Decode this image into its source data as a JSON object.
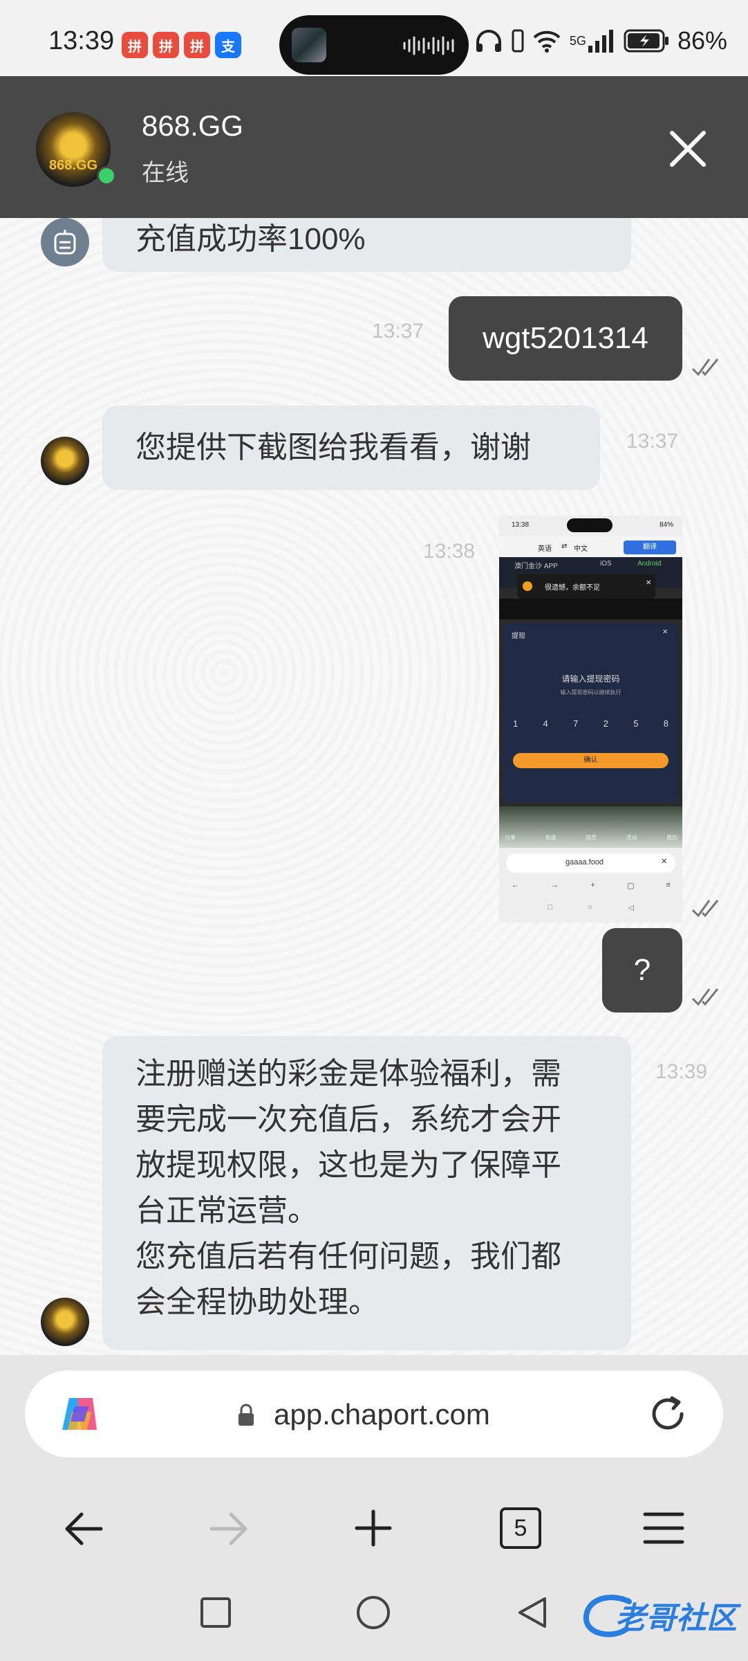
{
  "status_bar": {
    "time": "13:39",
    "notification_apps": [
      {
        "icon": "pinduoduo-icon",
        "color": "#e84c3d"
      },
      {
        "icon": "pinduoduo-icon",
        "color": "#e84c3d"
      },
      {
        "icon": "pinduoduo-icon",
        "color": "#e84c3d"
      },
      {
        "icon": "alipay-icon",
        "color": "#1677ff",
        "glyph": "支"
      }
    ],
    "network": "5G",
    "battery": "86%"
  },
  "header": {
    "agent_name": "868.GG",
    "agent_status": "在线",
    "avatar_text": "868.GG"
  },
  "messages": [
    {
      "id": "m0",
      "direction": "in",
      "sender": "bot",
      "text": "充值成功率100%"
    },
    {
      "id": "m1",
      "direction": "out",
      "text": "wgt5201314",
      "time": "13:37"
    },
    {
      "id": "m2",
      "direction": "in",
      "sender": "agent",
      "text": "您提供下截图给我看看，谢谢",
      "time": "13:37"
    },
    {
      "id": "m3",
      "direction": "out",
      "type": "image",
      "time": "13:38"
    },
    {
      "id": "m4",
      "direction": "out",
      "text": "?"
    },
    {
      "id": "m5",
      "direction": "in",
      "sender": "agent",
      "time": "13:39",
      "lines": [
        "注册赠送的彩金是体验福利，需",
        "要完成一次充值后，系统才会开",
        "放提现权限，这也是为了保障平",
        "台正常运营。",
        "您充值后若有任何问题，我们都",
        "会全程协助处理。"
      ]
    }
  ],
  "shot": {
    "time": "13:38",
    "battery": "84%",
    "translate_from": "英语",
    "translate_to": "中文",
    "translate_button": "翻译",
    "app_name": "澳门金沙 APP",
    "ios": "iOS",
    "android": "Android",
    "toast": "很遗憾，余额不足",
    "dialog_title": "提现",
    "dialog_heading": "请输入提现密码",
    "dialog_sub": "输入提现密码以继续执行",
    "digits": [
      "1",
      "4",
      "7",
      "2",
      "5",
      "8"
    ],
    "confirm": "确认",
    "tabs": [
      "分享",
      "充值",
      "首页",
      "活动",
      "我的"
    ],
    "url": "gaaaa.food"
  },
  "browser": {
    "url": "app.chaport.com",
    "tab_count": "5"
  },
  "watermark": "老哥社区"
}
